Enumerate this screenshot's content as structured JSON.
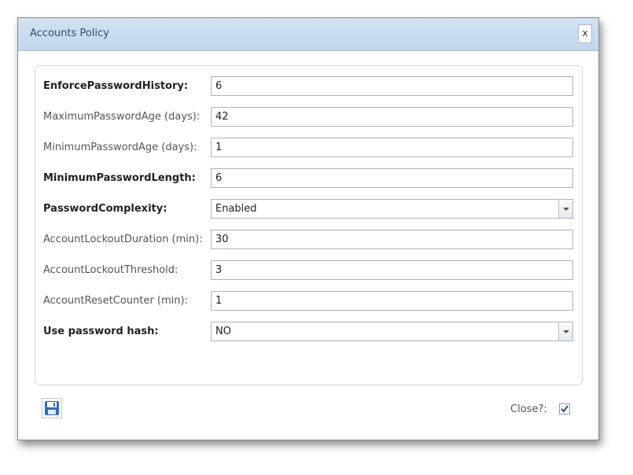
{
  "dialog": {
    "title": "Accounts Policy",
    "close_label": "x"
  },
  "fields": [
    {
      "label": "EnforcePasswordHistory:",
      "value": "6",
      "bold": true,
      "type": "text"
    },
    {
      "label": "MaximumPasswordAge (days):",
      "value": "42",
      "bold": false,
      "type": "text"
    },
    {
      "label": "MinimumPasswordAge (days):",
      "value": "1",
      "bold": false,
      "type": "text"
    },
    {
      "label": "MinimumPasswordLength:",
      "value": "6",
      "bold": true,
      "type": "text"
    },
    {
      "label": "PasswordComplexity:",
      "value": "Enabled",
      "bold": true,
      "type": "select"
    },
    {
      "label": "AccountLockoutDuration (min):",
      "value": "30",
      "bold": false,
      "type": "text"
    },
    {
      "label": "AccountLockoutThreshold:",
      "value": "3",
      "bold": false,
      "type": "text"
    },
    {
      "label": "AccountResetCounter (min):",
      "value": "1",
      "bold": false,
      "type": "text"
    },
    {
      "label": "Use password hash:",
      "value": "NO",
      "bold": true,
      "type": "select"
    }
  ],
  "footer": {
    "save_icon": "floppy-disk-icon",
    "close_label": "Close?:",
    "close_checked": true
  },
  "colors": {
    "titlebar": "#c8dbf0",
    "accent": "#2f6fb3"
  }
}
